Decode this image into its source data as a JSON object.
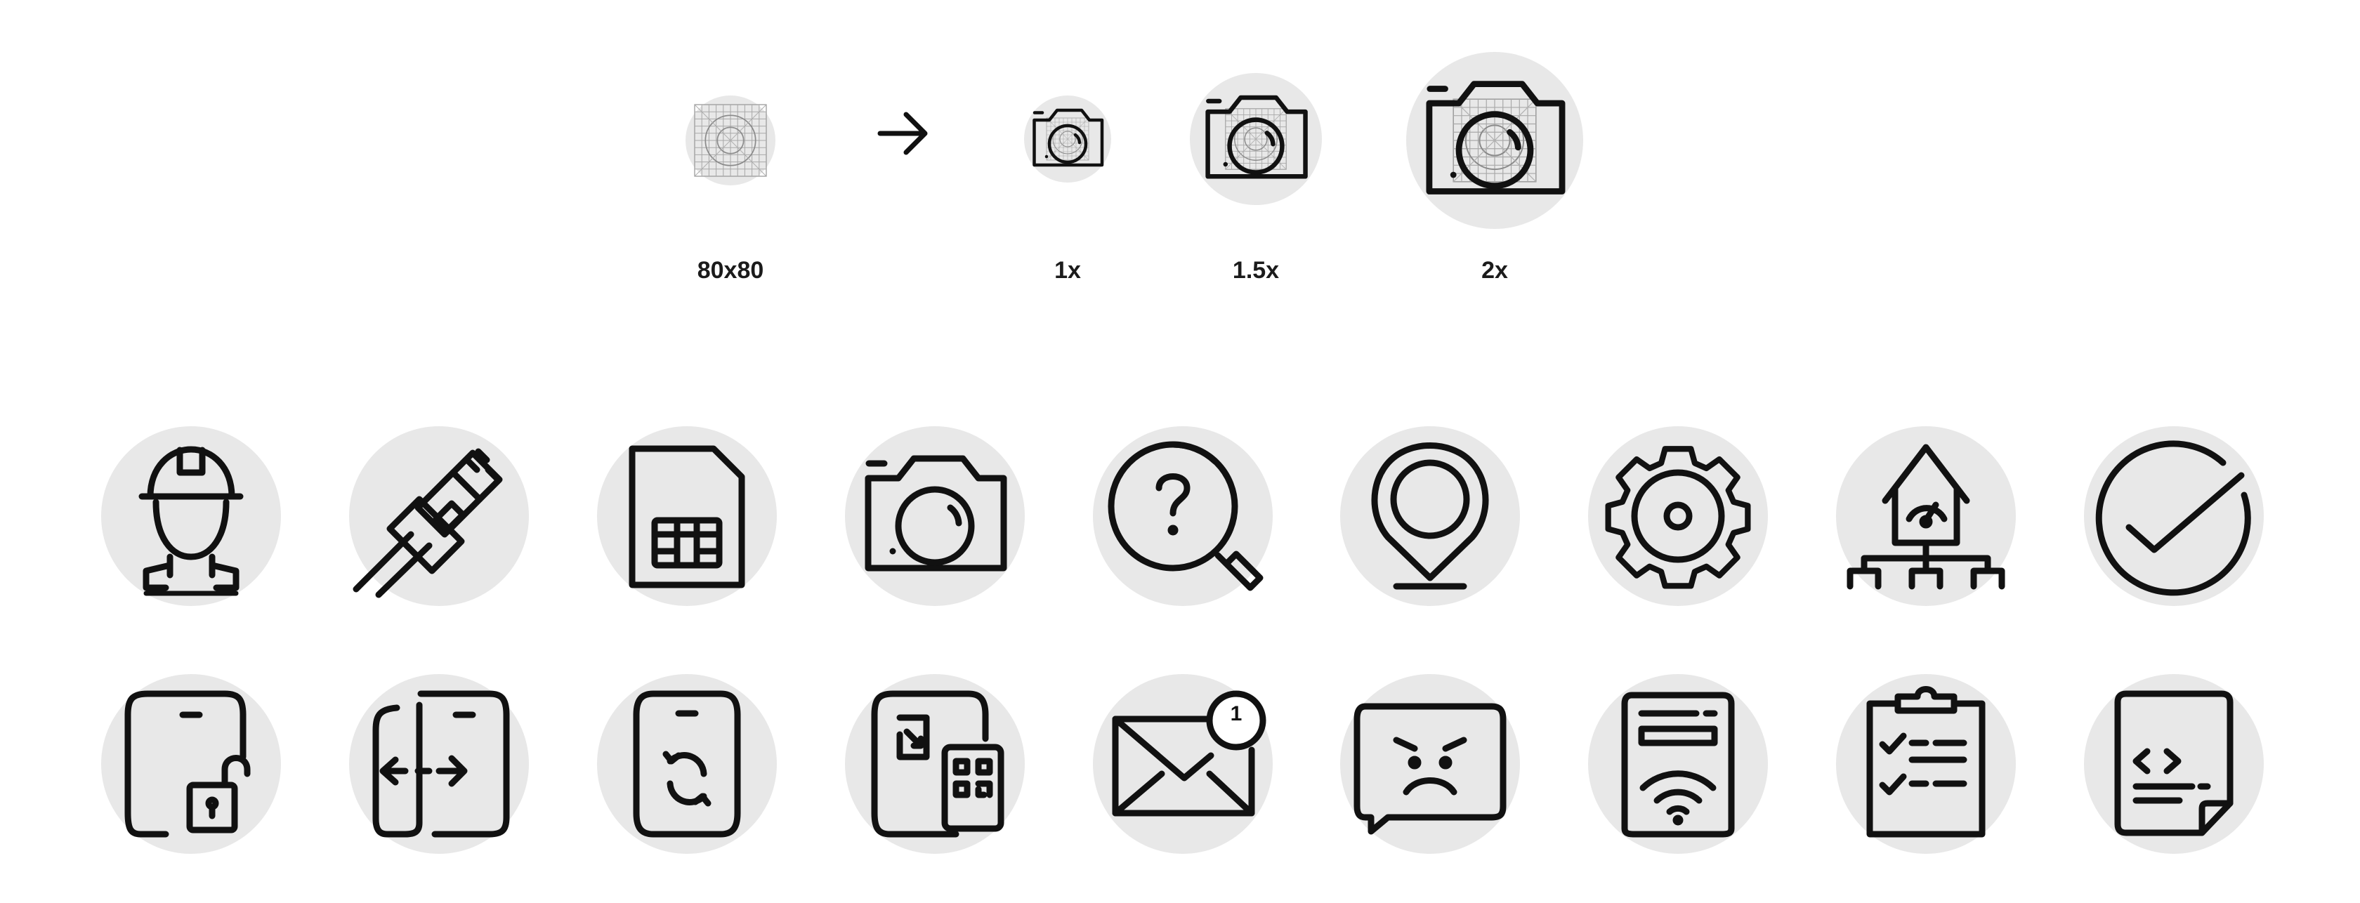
{
  "header_row": {
    "grid_label": "80x80",
    "scale_labels": [
      "1x",
      "1.5x",
      "2x"
    ]
  },
  "icons_row_1": [
    "worker-icon",
    "ethernet-cable-icon",
    "sim-card-icon",
    "camera-icon",
    "help-search-icon",
    "location-pin-icon",
    "gear-icon",
    "smart-home-network-icon",
    "checkmark-circle-icon"
  ],
  "icons_row_2": [
    "phone-unlock-icon",
    "phone-transfer-icon",
    "phone-sync-icon",
    "phone-qr-scan-icon",
    "mail-notification-icon",
    "sad-message-icon",
    "router-wifi-icon",
    "clipboard-checklist-icon",
    "code-document-icon"
  ],
  "mail_badge_count": "1",
  "colors": {
    "circle_background": "#e8e8e8",
    "stroke": "#111111",
    "grid_lines": "#9a9a9a"
  }
}
